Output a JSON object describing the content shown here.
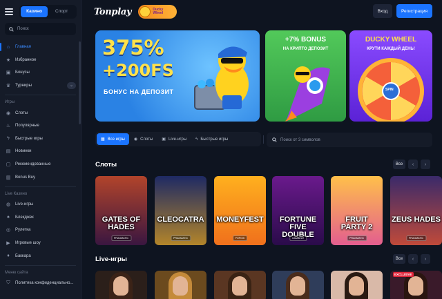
{
  "sidebar": {
    "tabs": [
      "Казино",
      "Спорт"
    ],
    "search_placeholder": "Поиск",
    "main_items": [
      {
        "label": "Главная",
        "icon": "home-icon"
      },
      {
        "label": "Избранное",
        "icon": "star-icon"
      },
      {
        "label": "Бонусы",
        "icon": "gift-icon"
      },
      {
        "label": "Турниры",
        "icon": "trophy-icon"
      }
    ],
    "games_title": "Игры",
    "games_items": [
      {
        "label": "Слоты",
        "icon": "slots-icon"
      },
      {
        "label": "Популярные",
        "icon": "fire-icon"
      },
      {
        "label": "Быстрые игры",
        "icon": "lightning-icon"
      },
      {
        "label": "Новинки",
        "icon": "new-icon"
      },
      {
        "label": "Рекомендованные",
        "icon": "thumb-icon"
      },
      {
        "label": "Bonus Buy",
        "icon": "bag-icon"
      }
    ],
    "live_title": "Live Казино",
    "live_items": [
      {
        "label": "Live-игры",
        "icon": "live-icon"
      },
      {
        "label": "Блекджек",
        "icon": "cards-icon"
      },
      {
        "label": "Рулетка",
        "icon": "roulette-icon"
      },
      {
        "label": "Игровые шоу",
        "icon": "show-icon"
      },
      {
        "label": "Баккара",
        "icon": "baccarat-icon"
      }
    ],
    "site_title": "Меню сайта",
    "site_items": [
      {
        "label": "Политика конфиденциально...",
        "icon": "shield-icon"
      }
    ]
  },
  "header": {
    "logo": "Tonplay",
    "promo_line1": "Ducky",
    "promo_line2": "Wheel",
    "login": "Вход",
    "register": "Регистрация"
  },
  "banners": {
    "main": {
      "line1": "375%",
      "line2": "+200FS",
      "line3": "БОНУС НА ДЕПОЗИТ"
    },
    "crypto": {
      "title": "+7% BONUS",
      "subtitle": "НА КРИПТО ДЕПОЗИТ"
    },
    "wheel": {
      "title": "DUCKY WHEEL",
      "subtitle": "КРУТИ КАЖДЫЙ ДЕНЬ!",
      "spin": "SPIN"
    }
  },
  "filters": {
    "tabs": [
      {
        "label": "Все игры",
        "icon": "grid-icon"
      },
      {
        "label": "Слоты",
        "icon": "slots-icon"
      },
      {
        "label": "Live-игры",
        "icon": "live-icon"
      },
      {
        "label": "Быстрые игры",
        "icon": "lightning-icon"
      }
    ],
    "search_placeholder": "Поиск от 3 символов"
  },
  "slots": {
    "title": "Слоты",
    "all": "Все",
    "games": [
      {
        "name": "GATES OF HADES",
        "provider": "PRAGMATIC",
        "color1": "#b2442b",
        "color2": "#3a1640"
      },
      {
        "name": "CLEOCATRA",
        "provider": "PRAGMATIC",
        "color1": "#1e2a64",
        "color2": "#b3852a"
      },
      {
        "name": "MONEYFEST",
        "provider": "POPIOK",
        "color1": "#ffb01e",
        "color2": "#f0701c"
      },
      {
        "name": "FORTUNE FIVE DOUBLE",
        "provider": "GAMBEAT",
        "color1": "#6a1a8c",
        "color2": "#2a0b4a"
      },
      {
        "name": "FRUIT PARTY 2",
        "provider": "PRAGMATIC",
        "color1": "#ffc04a",
        "color2": "#e35e8f"
      },
      {
        "name": "ZEUS HADES",
        "provider": "PRAGMATIC",
        "color1": "#3a2a6a",
        "color2": "#c04a3a"
      }
    ]
  },
  "live": {
    "title": "Live-игры",
    "all": "Все",
    "tiles": [
      {
        "bg": "#2b1f1a",
        "hair": "#3b2317"
      },
      {
        "bg": "#6b4a1e",
        "hair": "#c48a3a"
      },
      {
        "bg": "#5a3622",
        "hair": "#3a2314"
      },
      {
        "bg": "#2f3d5a",
        "hair": "#4a2c1c"
      },
      {
        "bg": "#d9b9a8",
        "hair": "#2a1a12"
      },
      {
        "bg": "#3a1a2a",
        "hair": "#2a1510",
        "badge": "EXCLUSIVE"
      }
    ]
  },
  "colors": {
    "accent": "#1b74ff",
    "bg": "#0e1420",
    "panel": "#151b28"
  }
}
